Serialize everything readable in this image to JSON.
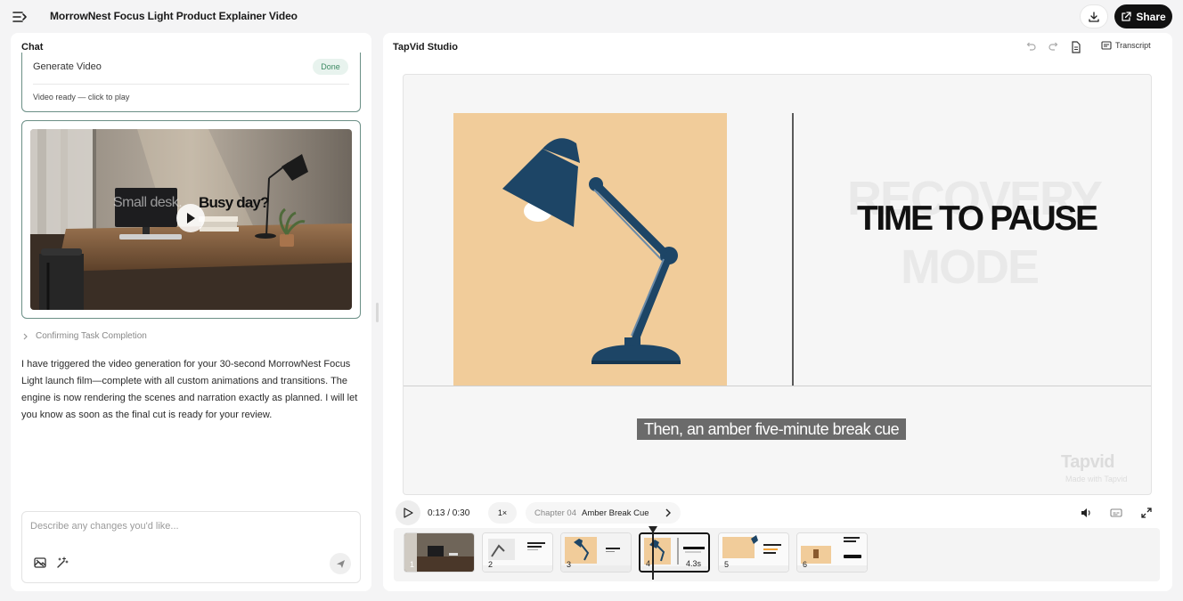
{
  "header": {
    "title": "MorrowNest Focus Light Product Explainer Video",
    "share_label": "Share"
  },
  "chat": {
    "header": "Chat",
    "task": {
      "title": "Generate Video",
      "status": "Done",
      "subtitle": "Video ready — click to play"
    },
    "video_preview": {
      "overlay_text_1": "Small desk.",
      "overlay_text_2": "Busy day?"
    },
    "confirm_label": "Confirming Task Completion",
    "message": "I have triggered the video generation for your 30-second MorrowNest Focus Light launch film—complete with all custom animations and transitions. The engine is now rendering the scenes and narration exactly as planned. I will let you know as soon as the final cut is ready for your review.",
    "composer": {
      "placeholder": "Describe any changes you'd like...",
      "value": ""
    }
  },
  "studio": {
    "title": "TapVid Studio",
    "transcript_label": "Transcript",
    "scene": {
      "ghost_line_1": "RECOVERY",
      "ghost_line_2": "MODE",
      "headline": "TIME TO PAUSE",
      "caption": "Then, an amber five-minute break cue",
      "watermark": "Tapvid",
      "watermark_sub": "Made with Tapvid"
    },
    "player": {
      "time": "0:13 / 0:30",
      "speed": "1×",
      "chapter_prefix": "Chapter 04",
      "chapter_name": "Amber Break Cue"
    },
    "clips": [
      {
        "num": "1",
        "duration": ""
      },
      {
        "num": "2",
        "duration": ""
      },
      {
        "num": "3",
        "duration": ""
      },
      {
        "num": "4",
        "duration": "4.3s"
      },
      {
        "num": "5",
        "duration": ""
      },
      {
        "num": "6",
        "duration": ""
      }
    ],
    "active_clip": "4"
  },
  "colors": {
    "accent_dark": "#111111",
    "scene_background": "#f1cc9a",
    "lamp_blue": "#1d4566",
    "done_green": "#3d8a63",
    "card_border": "#6b8f86"
  },
  "icons": {
    "menu": "sidebar-toggle-icon",
    "download": "download-icon",
    "share": "share-icon",
    "undo": "undo-icon",
    "redo": "redo-icon",
    "document": "document-icon",
    "transcript": "transcript-icon",
    "play": "play-icon",
    "volume": "volume-icon",
    "captions": "captions-icon",
    "fullscreen": "fullscreen-icon",
    "image_tool": "image-edit-icon",
    "magic_tool": "magic-wand-icon",
    "send": "send-icon"
  }
}
